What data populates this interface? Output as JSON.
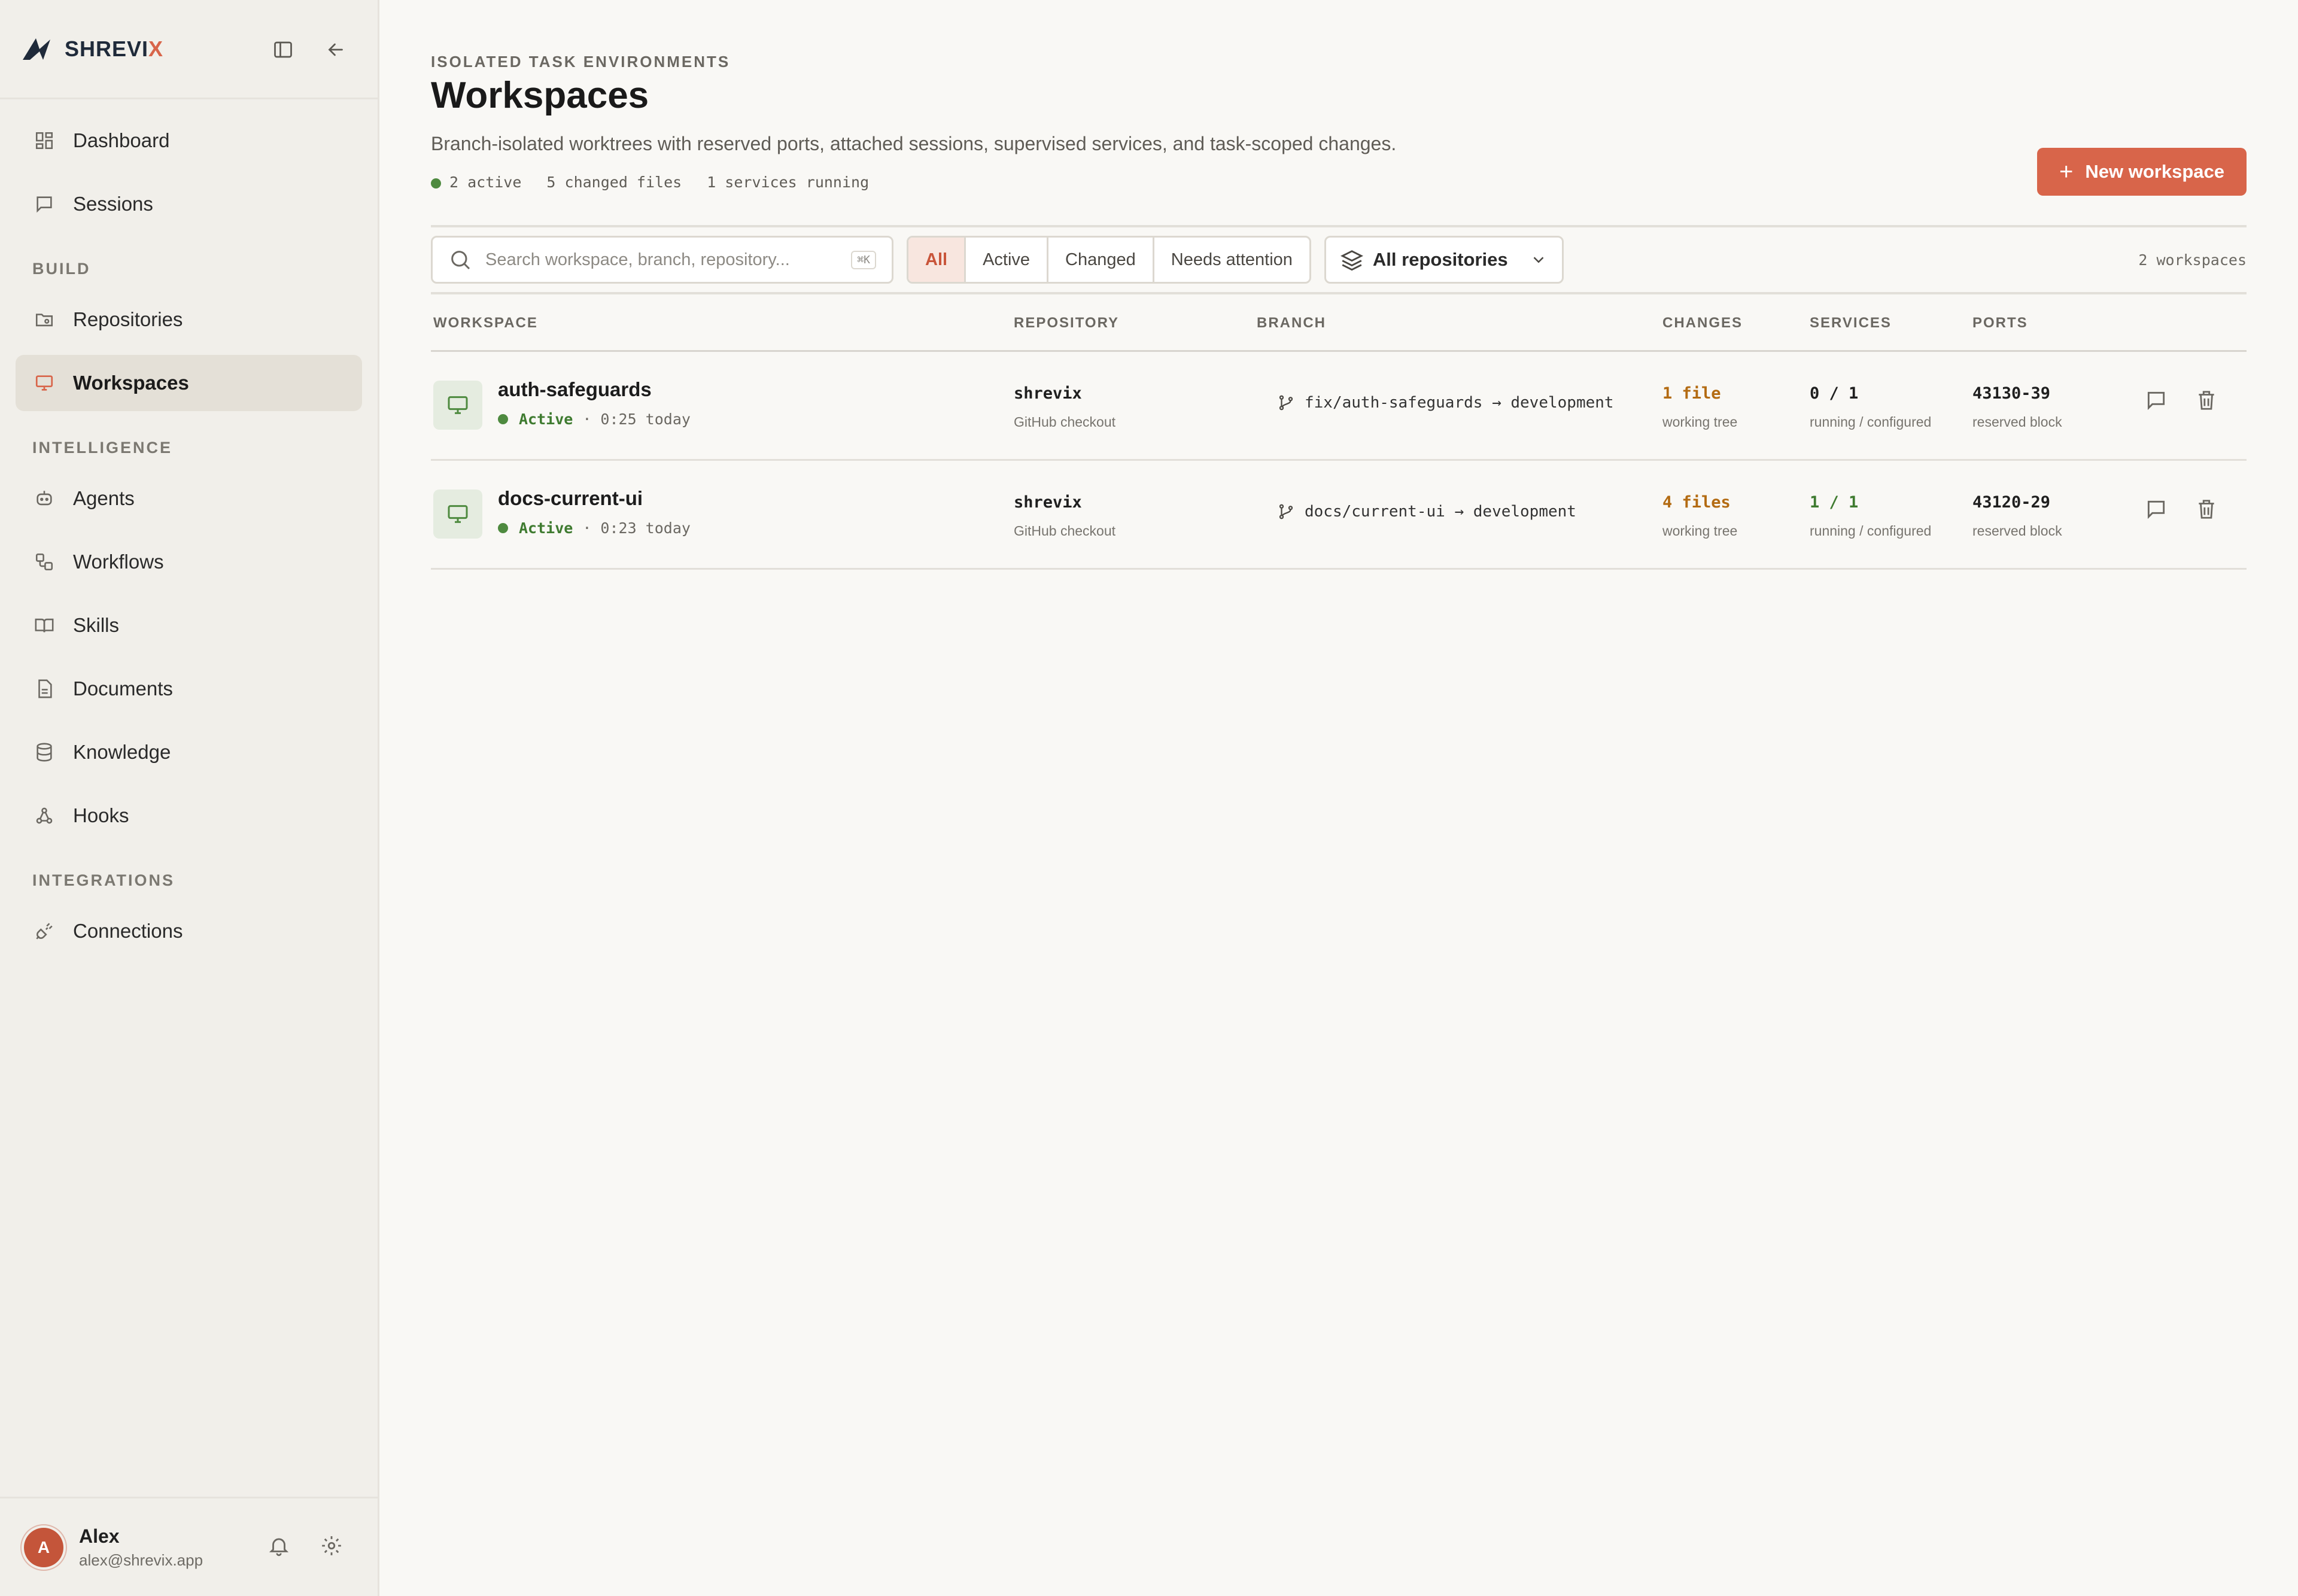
{
  "brand": {
    "name_prefix": "SHREVI",
    "name_suffix": "X"
  },
  "nav": {
    "top": [
      {
        "label": "Dashboard",
        "icon": "grid-icon"
      },
      {
        "label": "Sessions",
        "icon": "chat-icon"
      }
    ],
    "sections": [
      {
        "title": "BUILD",
        "items": [
          {
            "label": "Repositories",
            "icon": "folder-git-icon"
          },
          {
            "label": "Workspaces",
            "icon": "monitor-icon",
            "active": true
          }
        ]
      },
      {
        "title": "INTELLIGENCE",
        "items": [
          {
            "label": "Agents",
            "icon": "bot-icon"
          },
          {
            "label": "Workflows",
            "icon": "workflow-icon"
          },
          {
            "label": "Skills",
            "icon": "book-icon"
          },
          {
            "label": "Documents",
            "icon": "document-icon"
          },
          {
            "label": "Knowledge",
            "icon": "database-icon"
          },
          {
            "label": "Hooks",
            "icon": "webhook-icon"
          }
        ]
      },
      {
        "title": "INTEGRATIONS",
        "items": [
          {
            "label": "Connections",
            "icon": "plug-icon"
          }
        ]
      }
    ]
  },
  "user": {
    "initial": "A",
    "name": "Alex",
    "email": "alex@shrevix.app"
  },
  "header": {
    "eyebrow": "ISOLATED TASK ENVIRONMENTS",
    "title": "Workspaces",
    "description": "Branch-isolated worktrees with reserved ports, attached sessions, supervised services, and task-scoped changes.",
    "stats": [
      "2 active",
      "5 changed files",
      "1 services running"
    ],
    "new_button": "New workspace"
  },
  "toolbar": {
    "search_placeholder": "Search workspace, branch, repository...",
    "search_shortcut": "⌘K",
    "filters": [
      "All",
      "Active",
      "Changed",
      "Needs attention"
    ],
    "active_filter": "All",
    "repo_select": "All repositories",
    "count": "2 workspaces"
  },
  "table": {
    "columns": [
      "WORKSPACE",
      "REPOSITORY",
      "BRANCH",
      "CHANGES",
      "SERVICES",
      "PORTS"
    ],
    "rows": [
      {
        "name": "auth-safeguards",
        "status": "Active",
        "time": "· 0:25 today",
        "repo": "shrevix",
        "repo_sub": "GitHub checkout",
        "branch": "fix/auth-safeguards → development",
        "changes": "1 file",
        "changes_sub": "working tree",
        "services": "0 / 1",
        "services_sub": "running / configured",
        "ports": "43130-39",
        "ports_sub": "reserved block"
      },
      {
        "name": "docs-current-ui",
        "status": "Active",
        "time": "· 0:23 today",
        "repo": "shrevix",
        "repo_sub": "GitHub checkout",
        "branch": "docs/current-ui → development",
        "changes": "4 files",
        "changes_sub": "working tree",
        "services": "1 / 1",
        "services_sub": "running / configured",
        "ports": "43120-29",
        "ports_sub": "reserved block"
      }
    ]
  },
  "colors": {
    "accent": "#d8654a",
    "active_green": "#4e8a3f",
    "changes": "#b36b12"
  }
}
